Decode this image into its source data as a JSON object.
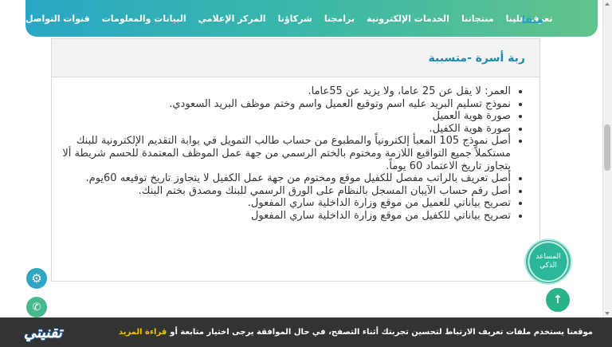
{
  "nav": {
    "current": "متقا",
    "items": [
      "تعرف علينا",
      "منتجاتنا",
      "الخدمات الإلكترونية",
      "برامجنا",
      "شركاؤنا",
      "المركز الإعلامي",
      "البيانات والمعلومات",
      "قنوات التواصل"
    ]
  },
  "panel": {
    "title": "ربة أسرة -متسببة",
    "requirements": [
      "العمر: لا يقل عن 25 عاما، ولا يزيد عن 55عاما.",
      "نموذج تسليم البريد عليه اسم وتوقيع العميل واسم وختم موظف البريد السعودي.",
      "صورة هوية العميل",
      "صورة هوية الكفيل.",
      "أصل نموذج 105 المعبأ إلكترونياً والمطبوع من حساب طالب التمويل في بوابة التقديم الإلكترونية للبنك مستكملاً جميع التواقيع اللازمة ومختوم بالختم الرسمي من جهة عمل الموظف المعتمدة للحسم شريطة ألا يتجاوز تاريخ الاعتماد 60 يوماً.",
      "أصل تعريف بالراتب مفصل للكفيل موقع ومختوم من جهة عمل الكفيل لا يتجاوز تاريخ توقيعه 60يوم.",
      "أصل رقم حساب الآيبان المسجل بالنظام على الورق الرسمي للبنك ومصدق بختم البنك.",
      "تصريح بياناتي للعميل من موقع وزارة الداخلية ساري المفعول.",
      "تصريح بياناتي للكفيل من موقع وزارة الداخلية ساري المفعول"
    ]
  },
  "assistant": {
    "line1": "المساعد",
    "line2": "الذكي"
  },
  "icons": {
    "settings": "gear-icon",
    "phone": "phone-icon",
    "up": "arrow-up-icon"
  },
  "cookie": {
    "text": "موقعنا يستخدم ملفات تعريف الارتباط لتحسين تجربتك أثناء التصفح، في حال الموافقة يرجى اختيار متابعة أو",
    "link": "قراءة المزيد"
  },
  "logo": {
    "text": "تقنيتي"
  },
  "colors": {
    "nav_start": "#2aa7c4",
    "nav_end": "#62c38b",
    "title": "#1e8ab0",
    "cookie_link": "#f2c200"
  }
}
